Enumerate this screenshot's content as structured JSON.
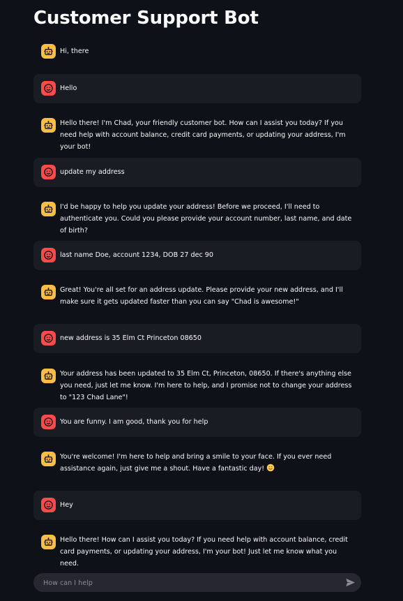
{
  "app": {
    "title": "Customer Support Bot"
  },
  "colors": {
    "background": "#0e1117",
    "user_bubble": "#1a1c24",
    "bot_avatar": "#ffbd45",
    "user_avatar": "#ff4b4b",
    "input_bg": "#262730"
  },
  "messages": [
    {
      "role": "assistant",
      "avatar_icon": "bot-face-icon",
      "text": "Hi, there"
    },
    {
      "role": "user",
      "avatar_icon": "smiley-face-icon",
      "text": "Hello"
    },
    {
      "role": "assistant",
      "avatar_icon": "bot-face-icon",
      "text": "Hello there! I'm Chad, your friendly customer bot. How can I assist you today? If you need help with account balance, credit card payments, or updating your address, I'm your bot!"
    },
    {
      "role": "user",
      "avatar_icon": "smiley-face-icon",
      "text": "update my address"
    },
    {
      "role": "assistant",
      "avatar_icon": "bot-face-icon",
      "text": "I'd be happy to help you update your address! Before we proceed, I'll need to authenticate you. Could you please provide your account number, last name, and date of birth?"
    },
    {
      "role": "user",
      "avatar_icon": "smiley-face-icon",
      "text": "last name Doe, account 1234, DOB 27 dec 90"
    },
    {
      "role": "assistant",
      "avatar_icon": "bot-face-icon",
      "text": "Great! You're all set for an address update. Please provide your new address, and I'll make sure it gets updated faster than you can say \"Chad is awesome!\""
    },
    {
      "role": "user",
      "avatar_icon": "smiley-face-icon",
      "text": "new address is 35 Elm Ct Princeton 08650"
    },
    {
      "role": "assistant",
      "avatar_icon": "bot-face-icon",
      "text": "Your address has been updated to 35 Elm Ct, Princeton, 08650. If there's anything else you need, just let me know. I'm here to help, and I promise not to change your address to \"123 Chad Lane\"!"
    },
    {
      "role": "user",
      "avatar_icon": "smiley-face-icon",
      "text": "You are funny. I am good, thank you for help"
    },
    {
      "role": "assistant",
      "avatar_icon": "bot-face-icon",
      "text": "You're welcome! I'm here to help and bring a smile to your face. If you ever need assistance again, just give me a shout. Have a fantastic day!",
      "trailing_emoji": "😊"
    },
    {
      "role": "user",
      "avatar_icon": "smiley-face-icon",
      "text": "Hey"
    },
    {
      "role": "assistant",
      "avatar_icon": "bot-face-icon",
      "text": "Hello there! How can I assist you today? If you need help with account balance, credit card payments, or updating your address, I'm your bot! Just let me know what you need."
    }
  ],
  "input": {
    "placeholder": "How can I help",
    "value": "",
    "send_icon": "send-icon"
  }
}
